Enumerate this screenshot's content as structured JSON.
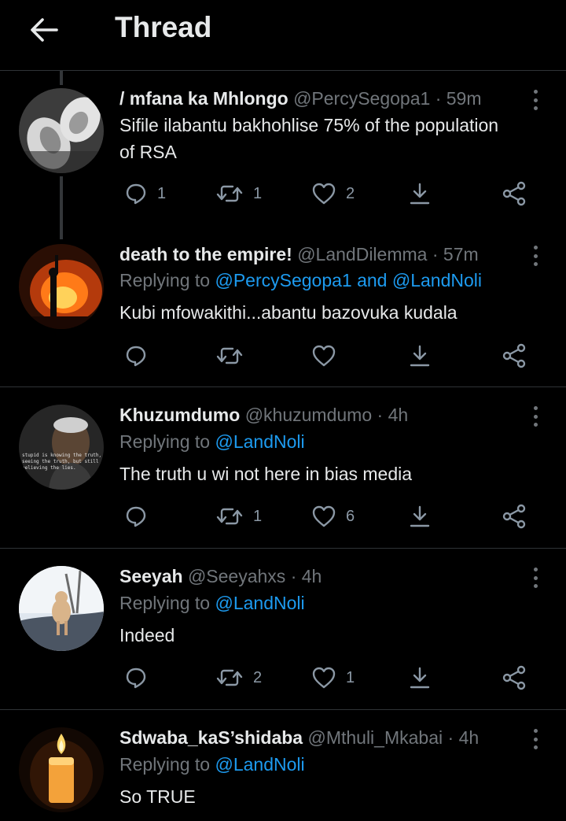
{
  "header": {
    "title": "Thread"
  },
  "tweets": [
    {
      "name": "/ mfana ka Mhlongo",
      "handle": "@PercySegopa1",
      "dot": "·",
      "time": "59m",
      "text_lines": [
        "Sifile ilabantu bakhohlise 75% of the population",
        "of RSA"
      ],
      "replies": "1",
      "retweets": "1",
      "likes": "2"
    },
    {
      "name": "death to the empire!",
      "handle": "@LandDilemma",
      "dot": "·",
      "time": "57m",
      "replying_prefix": "Replying to ",
      "replying_to": "@PercySegopa1 and @LandNoli",
      "text_lines": [
        "Kubi mfowakithi...abantu bazovuka kudala"
      ],
      "replies": "",
      "retweets": "",
      "likes": ""
    },
    {
      "name": "Khuzumdumo",
      "handle": "@khuzumdumo",
      "dot": "·",
      "time": "4h",
      "replying_prefix": "Replying to ",
      "replying_to": "@LandNoli",
      "avatar_caption": [
        "stupid is knowing the truth,",
        "seeing the truth, but still",
        "believing the lies."
      ],
      "text_lines": [
        "The truth u wi not here in bias media"
      ],
      "replies": "",
      "retweets": "1",
      "likes": "6"
    },
    {
      "name": "Seeyah",
      "handle": "@Seeyahxs",
      "dot": "·",
      "time": "4h",
      "replying_prefix": "Replying to ",
      "replying_to": "@LandNoli",
      "text_lines": [
        "Indeed"
      ],
      "replies": "",
      "retweets": "2",
      "likes": "1"
    },
    {
      "name": "Sdwaba_kaS’shidaba",
      "handle": "@Mthuli_Mkabai",
      "dot": "·",
      "time": "4h",
      "replying_prefix": "Replying to ",
      "replying_to": "@LandNoli",
      "text_lines": [
        "So TRUE"
      ]
    }
  ],
  "icons": {
    "back": "arrow-left-icon",
    "reply": "reply-icon",
    "retweet": "retweet-icon",
    "like": "heart-icon",
    "save": "save-download-icon",
    "share": "share-icon",
    "more": "more-vertical-icon"
  },
  "colors": {
    "background": "#000000",
    "text": "#e7e9ea",
    "muted": "#71767b",
    "link": "#1d9bf0",
    "divider": "#2f3336"
  }
}
